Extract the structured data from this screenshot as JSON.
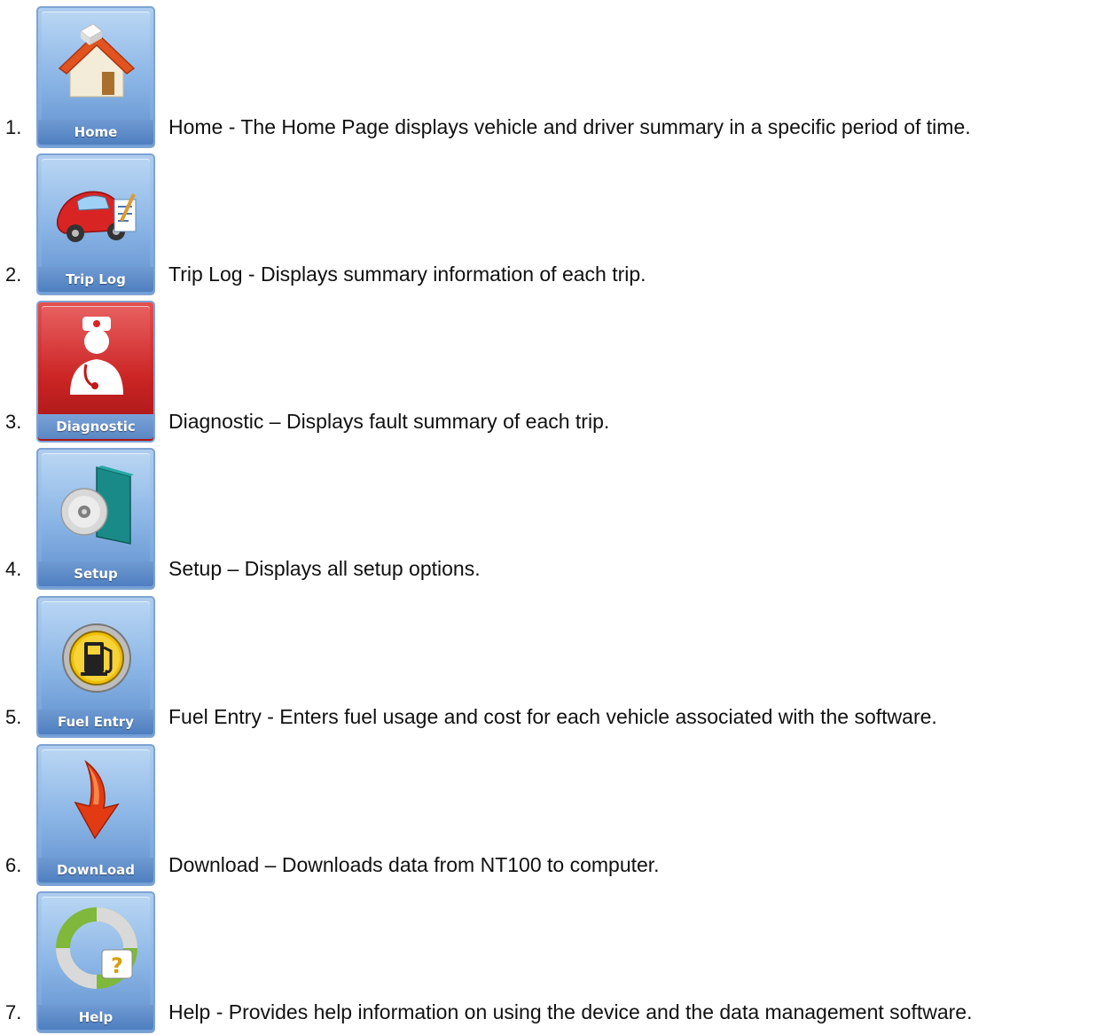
{
  "items": [
    {
      "number": "1.",
      "button_label": "Home",
      "icon": "home-icon",
      "description": "Home - The Home Page displays vehicle and driver summary in a specific period of time."
    },
    {
      "number": "2.",
      "button_label": "Trip Log",
      "icon": "car-log-icon",
      "description": "Trip Log - Displays summary information of each trip."
    },
    {
      "number": "3.",
      "button_label": "Diagnostic",
      "icon": "doctor-icon",
      "description": "Diagnostic – Displays fault summary of each trip."
    },
    {
      "number": "4.",
      "button_label": "Setup",
      "icon": "setup-disc-icon",
      "description": "Setup – Displays all setup options."
    },
    {
      "number": "5.",
      "button_label": "Fuel Entry",
      "icon": "fuel-pump-icon",
      "description": "Fuel Entry - Enters fuel usage and cost for each vehicle associated with the software."
    },
    {
      "number": "6.",
      "button_label": "DownLoad",
      "icon": "download-arrow-icon",
      "description": "Download – Downloads data from NT100 to computer."
    },
    {
      "number": "7.",
      "button_label": "Help",
      "icon": "help-lifebuoy-icon",
      "description": "Help - Provides help information on using the device and the data management software."
    }
  ],
  "colors": {
    "tile_blue": "#8ab4e5",
    "tile_red": "#c71f1f",
    "label_blue": "#5a87c4"
  }
}
